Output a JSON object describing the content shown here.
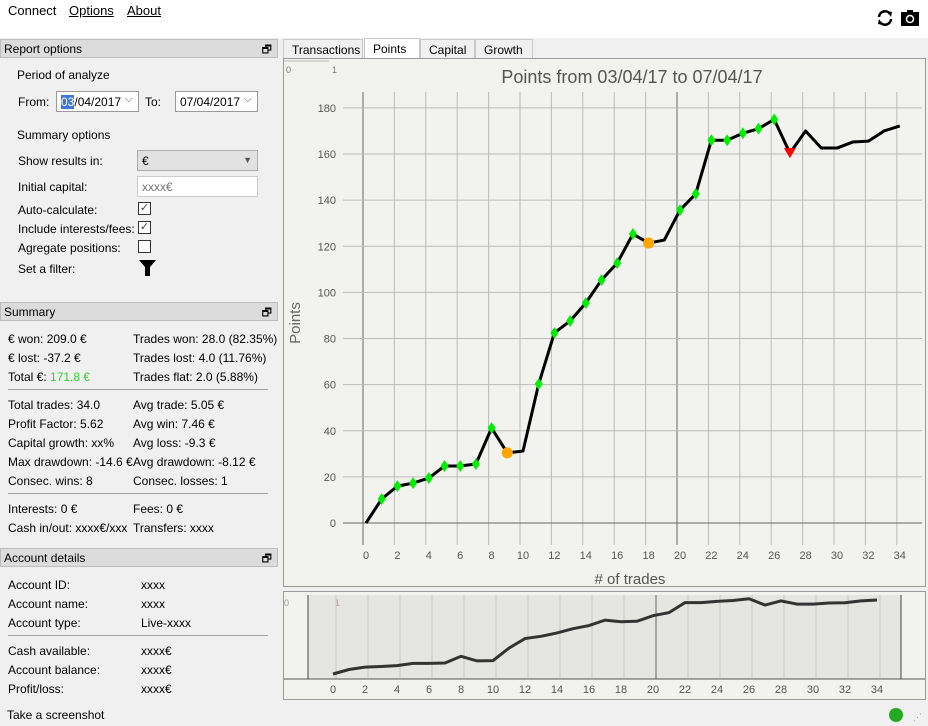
{
  "menu": {
    "connect": "Connect",
    "options": "Options",
    "about": "About"
  },
  "toolbar": {
    "refresh_icon": "refresh-icon",
    "camera_icon": "camera-icon"
  },
  "report_options": {
    "title": "Report options",
    "period_label": "Period of analyze",
    "from_label": "From:",
    "from_sel": "03",
    "from_rest": "/04/2017",
    "to_label": "To:",
    "to_value": "07/04/2017",
    "summary_label": "Summary options",
    "show_results_label": "Show results in:",
    "show_results_value": "€",
    "initial_capital_label": "Initial capital:",
    "initial_capital_placeholder": "xxxx€",
    "auto_calc_label": "Auto-calculate:",
    "auto_calc": true,
    "include_label": "Include interests/fees:",
    "include": true,
    "aggregate_label": "Agregate positions:",
    "aggregate": false,
    "filter_label": "Set a filter:"
  },
  "summary": {
    "title": "Summary",
    "rows1": [
      [
        "€ won: 209.0 €",
        "Trades won: 28.0 (82.35%)"
      ],
      [
        "€ lost: -37.2 €",
        "Trades lost: 4.0 (11.76%)"
      ]
    ],
    "total_label": "Total €: ",
    "total_value": "171.8 €",
    "total_color": "#33cc33",
    "flat": "Trades flat: 2.0 (5.88%)",
    "rows2": [
      [
        "Total trades: 34.0",
        "Avg trade: 5.05 €"
      ],
      [
        "Profit Factor: 5.62",
        "Avg win: 7.46 €"
      ],
      [
        "Capital growth: xx%",
        "Avg loss: -9.3 €"
      ],
      [
        "Max drawdown: -14.6 €",
        "Avg drawdown: -8.12 €"
      ],
      [
        "Consec. wins: 8",
        "Consec. losses: 1"
      ]
    ],
    "rows3": [
      [
        "Interests: 0 €",
        "Fees: 0 €"
      ],
      [
        "Cash in/out: xxxx€/xxx",
        "Transfers: xxxx"
      ]
    ]
  },
  "account": {
    "title": "Account details",
    "rows1": [
      [
        "Account ID:",
        "xxxx"
      ],
      [
        "Account name:",
        "xxxx"
      ],
      [
        "Account type:",
        "Live-xxxx"
      ]
    ],
    "rows2": [
      [
        "Cash available:",
        "xxxx€"
      ],
      [
        "Account balance:",
        "xxxx€"
      ],
      [
        "Profit/loss:",
        "xxxx€"
      ]
    ]
  },
  "tabs": [
    "Transactions",
    "Points",
    "Capital",
    "Growth"
  ],
  "status": {
    "text": "Take a screenshot",
    "indicator_color": "#22aa22"
  },
  "chart_data": {
    "type": "line",
    "title": "Points from 03/04/17 to 07/04/17",
    "xlabel": "# of trades",
    "ylabel": "Points",
    "xlim": [
      0,
      34
    ],
    "ylim": [
      0,
      180
    ],
    "xticks": [
      0,
      2,
      4,
      6,
      8,
      10,
      12,
      14,
      16,
      18,
      20,
      22,
      24,
      26,
      28,
      30,
      32,
      34
    ],
    "yticks": [
      0,
      20,
      40,
      60,
      80,
      100,
      120,
      140,
      160,
      180
    ],
    "corner_labels": [
      "0",
      "1"
    ],
    "x": [
      0,
      1,
      2,
      3,
      4,
      5,
      6,
      7,
      8,
      9,
      10,
      11,
      12,
      13,
      14,
      15,
      16,
      17,
      18,
      19,
      20,
      21,
      22,
      23,
      24,
      25,
      26,
      27,
      28,
      29,
      30,
      31,
      32,
      33,
      34
    ],
    "y": [
      0,
      10.4,
      16,
      17.3,
      19.5,
      24.7,
      24.7,
      25.6,
      41.2,
      30.4,
      31.2,
      60.3,
      82.4,
      87.6,
      95.4,
      105.4,
      112.7,
      125.3,
      121.4,
      122.7,
      135.7,
      142.7,
      166,
      166,
      169,
      171,
      175,
      160.4,
      170,
      162.6,
      162.6,
      165.2,
      165.6,
      170,
      172.2
    ],
    "markers": {
      "win": [
        1,
        2,
        3,
        4,
        5,
        6,
        7,
        8,
        11,
        12,
        13,
        14,
        15,
        16,
        17,
        20,
        21,
        22,
        23,
        24,
        25,
        26
      ],
      "flat": [
        9,
        18
      ],
      "loss": [
        27
      ]
    },
    "colors": {
      "line": "#000000",
      "win": "#00ee00",
      "flat": "#ffa500",
      "loss": "#ff0000"
    }
  }
}
